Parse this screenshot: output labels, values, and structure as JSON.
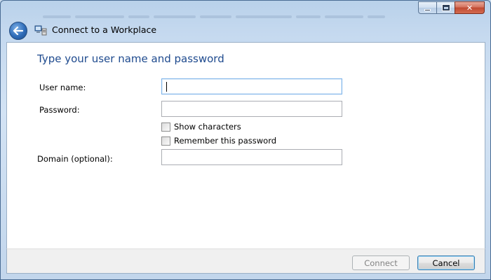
{
  "window": {
    "title": "Connect to a Workplace",
    "caption_buttons": {
      "minimize": "minimize",
      "maximize": "maximize",
      "close": "✕"
    }
  },
  "icons": {
    "back": "back-arrow-icon",
    "app": "workplace-network-icon"
  },
  "main": {
    "instruction": "Type your user name and password",
    "fields": {
      "username": {
        "label": "User name:",
        "value": ""
      },
      "password": {
        "label": "Password:",
        "value": ""
      },
      "domain": {
        "label": "Domain (optional):",
        "value": ""
      }
    },
    "checkboxes": {
      "show_characters": {
        "label": "Show characters",
        "checked": false
      },
      "remember_password": {
        "label": "Remember this password",
        "checked": false
      }
    }
  },
  "footer": {
    "connect_label": "Connect",
    "connect_enabled": false,
    "cancel_label": "Cancel"
  },
  "colors": {
    "instruction_text": "#1e4a8e",
    "frame": "#c5d9ef",
    "close_button": "#c04a32"
  }
}
